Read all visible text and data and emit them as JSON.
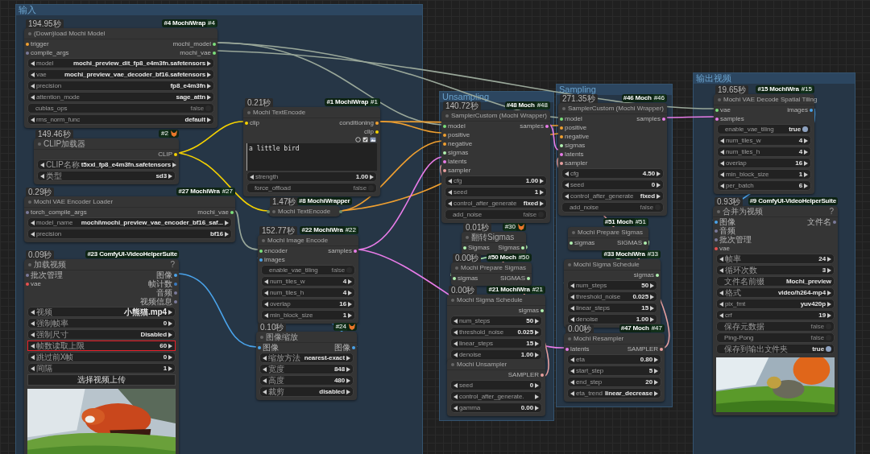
{
  "groups": [
    {
      "title": "输入"
    },
    {
      "title": "Unsampling"
    },
    {
      "title": "Sampling"
    },
    {
      "title": "输出视频"
    }
  ],
  "nodes": [
    {
      "time": "194.95秒",
      "badge": {
        "kind": "pack",
        "text": "#4 MochiWrap",
        "id": "#4"
      },
      "title": "(Down)load Mochi Model",
      "collapsed": false,
      "inputs": [
        {
          "name": "trigger",
          "color": "#f0a030"
        },
        {
          "name": "compile_args",
          "color": "#7a7a9a"
        }
      ],
      "outputs": [
        {
          "name": "mochi_model",
          "color": "#7be07b"
        },
        {
          "name": "mochi_vae",
          "color": "#7be07b"
        }
      ],
      "widgets": [
        {
          "kind": "combo",
          "label": "model",
          "value": "mochi_preview_dit_fp8_e4m3fn.safetensors"
        },
        {
          "kind": "combo",
          "label": "vae",
          "value": "mochi_preview_vae_decoder_bf16.safetensors"
        },
        {
          "kind": "combo",
          "label": "precision",
          "value": "fp8_e4m3fn"
        },
        {
          "kind": "combo",
          "label": "attention_mode",
          "value": "sage_attn"
        },
        {
          "kind": "toggle",
          "label": "cublas_ops",
          "value": "false",
          "on": false
        },
        {
          "kind": "combo",
          "label": "rms_norm_func",
          "value": "default"
        }
      ]
    },
    {
      "time": "149.46秒",
      "badge": {
        "kind": "core",
        "id": "#2"
      },
      "title": "CLIP加载器",
      "collapsed": false,
      "outputs": [
        {
          "name": "CLIP",
          "color": "#f5d200"
        }
      ],
      "widgets": [
        {
          "kind": "combo",
          "label": "CLIP名称",
          "value": "t5xxl_fp8_e4m3fn.safetensors"
        },
        {
          "kind": "combo",
          "label": "类型",
          "value": "sd3"
        }
      ]
    },
    {
      "time": "0.29秒",
      "badge": {
        "kind": "pack",
        "text": "#27 MochiWra",
        "id": "#27"
      },
      "title": "Mochi VAE Encoder Loader",
      "collapsed": false,
      "inputs": [
        {
          "name": "torch_compile_args",
          "color": "#7a7a9a"
        }
      ],
      "outputs": [
        {
          "name": "mochi_vae",
          "color": "#7be07b"
        }
      ],
      "widgets": [
        {
          "kind": "combo",
          "label": "model_name",
          "value": "mochi\\mochi_preview_vae_encoder_bf16_saf..."
        },
        {
          "kind": "combo",
          "label": "precision",
          "value": "bf16"
        }
      ]
    },
    {
      "time": "0.09秒",
      "badge": {
        "kind": "pack",
        "text": "#23 ComfyUI-VideoHelperSuite"
      },
      "title": "加载视频",
      "help": "?",
      "collapsed": false,
      "inputs": [
        {
          "name": "批次管理",
          "color": "#7a7a9a"
        },
        {
          "name": "vae",
          "color": "#e85050"
        }
      ],
      "outputs": [
        {
          "name": "图像",
          "color": "#4aa3ea"
        },
        {
          "name": "帧计数",
          "color": "#3a7ac0"
        },
        {
          "name": "音频",
          "color": "#7a7a9a"
        },
        {
          "name": "视频信息",
          "color": "#7a7a9a"
        }
      ],
      "widgets": [
        {
          "kind": "combo",
          "label": "视频",
          "value": "小熊猫.mp4",
          "highlighted": false
        },
        {
          "kind": "number",
          "label": "强制帧率",
          "value": "0",
          "highlighted": false
        },
        {
          "kind": "combo",
          "label": "强制尺寸",
          "value": "Disabled",
          "highlighted": false
        },
        {
          "kind": "number",
          "label": "帧数读取上限",
          "value": "60",
          "highlighted": true
        },
        {
          "kind": "number",
          "label": "跳过前X帧",
          "value": "0",
          "highlighted": false
        },
        {
          "kind": "number",
          "label": "间隔",
          "value": "1",
          "highlighted": false
        },
        {
          "kind": "button",
          "label": "选择视频上传",
          "highlighted": false
        },
        {
          "kind": "picture"
        }
      ]
    },
    {
      "time": "0.21秒",
      "badge": {
        "kind": "pack",
        "text": "#1 MochiWrap",
        "id": "#1"
      },
      "title": "Mochi TextEncode",
      "collapsed": false,
      "inputs": [
        {
          "name": "clip",
          "color": "#f5d200"
        }
      ],
      "outputs": [
        {
          "name": "conditioning",
          "color": "#f0a030"
        },
        {
          "name": "clip",
          "color": "#f5d200"
        }
      ],
      "widgets": [
        {
          "kind": "icons"
        },
        {
          "kind": "textarea",
          "value": "a little bird"
        },
        {
          "kind": "number",
          "label": "strength",
          "value": "1.00"
        },
        {
          "kind": "toggle",
          "label": "force_offload",
          "value": "false",
          "on": false
        }
      ]
    },
    {
      "time": "1.47秒",
      "badge": {
        "kind": "pack",
        "text": "#8 MochiWrapper"
      },
      "title": "Mochi TextEncode",
      "collapsed": true
    },
    {
      "time": "152.77秒",
      "badge": {
        "kind": "pack",
        "text": "#22 MochiWra",
        "id": "#22"
      },
      "title": "Mochi Image Encode",
      "collapsed": false,
      "inputs": [
        {
          "name": "encoder",
          "color": "#7be07b"
        },
        {
          "name": "images",
          "color": "#4aa3ea"
        }
      ],
      "outputs": [
        {
          "name": "samples",
          "color": "#e87ce8"
        }
      ],
      "widgets": [
        {
          "kind": "toggle",
          "label": "enable_vae_tiling",
          "value": "false",
          "on": false
        },
        {
          "kind": "number",
          "label": "num_tiles_w",
          "value": "4"
        },
        {
          "kind": "number",
          "label": "num_tiles_h",
          "value": "4"
        },
        {
          "kind": "number",
          "label": "overlap",
          "value": "16"
        },
        {
          "kind": "number",
          "label": "min_block_size",
          "value": "1"
        }
      ]
    },
    {
      "time": "0.10秒",
      "badge": {
        "kind": "core",
        "id": "#24"
      },
      "title": "图像缩放",
      "collapsed": false,
      "inputs": [
        {
          "name": "图像",
          "color": "#4aa3ea"
        }
      ],
      "outputs": [
        {
          "name": "图像",
          "color": "#4aa3ea"
        }
      ],
      "widgets": [
        {
          "kind": "combo",
          "label": "缩放方法",
          "value": "nearest-exact"
        },
        {
          "kind": "number",
          "label": "宽度",
          "value": "848"
        },
        {
          "kind": "number",
          "label": "高度",
          "value": "480"
        },
        {
          "kind": "combo",
          "label": "裁剪",
          "value": "disabled"
        }
      ]
    },
    {
      "time": "140.72秒",
      "badge": {
        "kind": "pack",
        "text": "#48 Moch",
        "id": "#48"
      },
      "title": "SamplerCustom (Mochi Wrapper)",
      "collapsed": false,
      "inputs": [
        {
          "name": "model",
          "color": "#7be07b"
        },
        {
          "name": "positive",
          "color": "#f0a030"
        },
        {
          "name": "negative",
          "color": "#f0a030"
        },
        {
          "name": "sigmas",
          "color": "#b0f0b0"
        },
        {
          "name": "latents",
          "color": "#e87ce8"
        },
        {
          "name": "sampler",
          "color": "#e8a0a0"
        }
      ],
      "outputs": [
        {
          "name": "samples",
          "color": "#e87ce8"
        }
      ],
      "widgets": [
        {
          "kind": "number",
          "label": "cfg",
          "value": "1.00"
        },
        {
          "kind": "number",
          "label": "seed",
          "value": "1"
        },
        {
          "kind": "combo",
          "label": "control_after_generate",
          "value": "fixed"
        },
        {
          "kind": "toggle",
          "label": "add_noise",
          "value": "false",
          "on": false
        }
      ]
    },
    {
      "time": "0.01秒",
      "badge": {
        "kind": "core",
        "id": "#30"
      },
      "title": "翻转Sigmas",
      "collapsed": false,
      "inputs": [
        {
          "name": "Sigmas",
          "color": "#b0f0b0"
        }
      ],
      "outputs": [
        {
          "name": "Sigmas",
          "color": "#b0f0b0"
        }
      ]
    },
    {
      "time": "0.00秒",
      "badge": {
        "kind": "pack",
        "text": "#50 Moch",
        "id": "#50"
      },
      "title": "Mochi Prepare Sigmas",
      "collapsed": false,
      "inputs": [
        {
          "name": "sigmas",
          "color": "#b0f0b0"
        }
      ],
      "outputs": [
        {
          "name": "SIGMAS",
          "color": "#b0f0b0"
        }
      ]
    },
    {
      "time": "0.00秒",
      "badge": {
        "kind": "pack",
        "text": "#21 MochiWra",
        "id": "#21"
      },
      "title": "Mochi Sigma Schedule",
      "collapsed": false,
      "outputs": [
        {
          "name": "sigmas",
          "color": "#b0f0b0"
        }
      ],
      "widgets": [
        {
          "kind": "number",
          "label": "num_steps",
          "value": "50"
        },
        {
          "kind": "number",
          "label": "threshold_noise",
          "value": "0.025"
        },
        {
          "kind": "number",
          "label": "linear_steps",
          "value": "15"
        },
        {
          "kind": "number",
          "label": "denoise",
          "value": "1.00"
        }
      ]
    },
    {
      "title": "Mochi Unsampler",
      "collapsed": false,
      "outputs": [
        {
          "name": "SAMPLER",
          "color": "#e8a0a0"
        }
      ],
      "widgets": [
        {
          "kind": "number",
          "label": "seed",
          "value": "0"
        },
        {
          "kind": "combo",
          "label": "control_after_generate."
        },
        {
          "kind": "number",
          "label": "gamma",
          "value": "0.00"
        }
      ]
    },
    {
      "time": "271.35秒",
      "badge": {
        "kind": "pack",
        "text": "#46 Moch",
        "id": "#46"
      },
      "title": "SamplerCustom (Mochi Wrapper)",
      "collapsed": false,
      "inputs": [
        {
          "name": "model",
          "color": "#7be07b"
        },
        {
          "name": "positive",
          "color": "#f0a030"
        },
        {
          "name": "negative",
          "color": "#f0a030"
        },
        {
          "name": "sigmas",
          "color": "#b0f0b0"
        },
        {
          "name": "latents",
          "color": "#e87ce8"
        },
        {
          "name": "sampler",
          "color": "#e8a0a0"
        }
      ],
      "outputs": [
        {
          "name": "samples",
          "color": "#e87ce8"
        }
      ],
      "widgets": [
        {
          "kind": "number",
          "label": "cfg",
          "value": "4.50"
        },
        {
          "kind": "number",
          "label": "seed",
          "value": "0"
        },
        {
          "kind": "combo",
          "label": "control_after_generate",
          "value": "fixed"
        },
        {
          "kind": "toggle",
          "label": "add_noise",
          "value": "false",
          "on": false
        }
      ]
    },
    {
      "badge": {
        "kind": "pack",
        "text": "#51 Moch",
        "id": "#51"
      },
      "title": "Mochi Prepare Sigmas",
      "collapsed": false,
      "inputs": [
        {
          "name": "sigmas",
          "color": "#b0f0b0"
        }
      ],
      "outputs": [
        {
          "name": "SIGMAS",
          "color": "#b0f0b0"
        }
      ]
    },
    {
      "badge": {
        "kind": "pack",
        "text": "#33 MochiWra",
        "id": "#33"
      },
      "title": "Mochi Sigma Schedule",
      "collapsed": false,
      "outputs": [
        {
          "name": "sigmas",
          "color": "#b0f0b0"
        }
      ],
      "widgets": [
        {
          "kind": "number",
          "label": "num_steps",
          "value": "50"
        },
        {
          "kind": "number",
          "label": "threshold_noise",
          "value": "0.025"
        },
        {
          "kind": "number",
          "label": "linear_steps",
          "value": "15"
        },
        {
          "kind": "number",
          "label": "denoise",
          "value": "1.00"
        }
      ]
    },
    {
      "time": "0.00秒",
      "badge": {
        "kind": "pack",
        "text": "#47 Moch",
        "id": "#47"
      },
      "title": "Mochi Resampler",
      "collapsed": false,
      "inputs": [
        {
          "name": "latents",
          "color": "#e87ce8"
        }
      ],
      "outputs": [
        {
          "name": "SAMPLER",
          "color": "#e8a0a0"
        }
      ],
      "widgets": [
        {
          "kind": "number",
          "label": "eta",
          "value": "0.80"
        },
        {
          "kind": "number",
          "label": "start_step",
          "value": "5"
        },
        {
          "kind": "number",
          "label": "end_step",
          "value": "20"
        },
        {
          "kind": "combo",
          "label": "eta_trend",
          "value": "linear_decrease"
        }
      ]
    },
    {
      "time": "19.65秒",
      "badge": {
        "kind": "pack",
        "text": "#15 MochiWra",
        "id": "#15"
      },
      "title": "Mochi VAE Decode Spatial Tiling",
      "collapsed": false,
      "inputs": [
        {
          "name": "vae",
          "color": "#7be07b"
        },
        {
          "name": "samples",
          "color": "#e87ce8"
        }
      ],
      "outputs": [
        {
          "name": "images",
          "color": "#4aa3ea"
        }
      ],
      "widgets": [
        {
          "kind": "toggle",
          "label": "enable_vae_tiling",
          "value": "true",
          "on": true
        },
        {
          "kind": "number",
          "label": "num_tiles_w",
          "value": "4"
        },
        {
          "kind": "number",
          "label": "num_tiles_h",
          "value": "4"
        },
        {
          "kind": "number",
          "label": "overlap",
          "value": "16"
        },
        {
          "kind": "number",
          "label": "min_block_size",
          "value": "1"
        },
        {
          "kind": "number",
          "label": "per_batch",
          "value": "6"
        }
      ]
    },
    {
      "time": "0.93秒",
      "badge": {
        "kind": "pack",
        "text": "#9 ComfyUI-VideoHelperSuite"
      },
      "title": "合并为视频",
      "help": "?",
      "collapsed": false,
      "inputs": [
        {
          "name": "图像",
          "color": "#4aa3ea"
        },
        {
          "name": "音频",
          "color": "#7a7a9a"
        },
        {
          "name": "批次管理",
          "color": "#7a7a9a"
        },
        {
          "name": "vae",
          "color": "#e85050"
        }
      ],
      "outputs": [
        {
          "name": "文件名",
          "color": "#7a7a9a"
        }
      ],
      "widgets": [
        {
          "kind": "number",
          "label": "帧率",
          "value": "24"
        },
        {
          "kind": "number",
          "label": "循环次数",
          "value": "3"
        },
        {
          "kind": "text",
          "label": "文件名前缀",
          "value": "Mochi_preview"
        },
        {
          "kind": "combo",
          "label": "格式",
          "value": "video/h264-mp4"
        },
        {
          "kind": "combo",
          "label": "pix_fmt",
          "value": "yuv420p"
        },
        {
          "kind": "number",
          "label": "crf",
          "value": "19"
        },
        {
          "kind": "toggle",
          "label": "保存元数据",
          "value": "false",
          "on": false
        },
        {
          "kind": "toggle",
          "label": "Ping-Pong",
          "value": "false",
          "on": false
        },
        {
          "kind": "toggle",
          "label": "保存到输出文件夹",
          "value": "true",
          "on": true
        },
        {
          "kind": "picture"
        }
      ]
    }
  ]
}
